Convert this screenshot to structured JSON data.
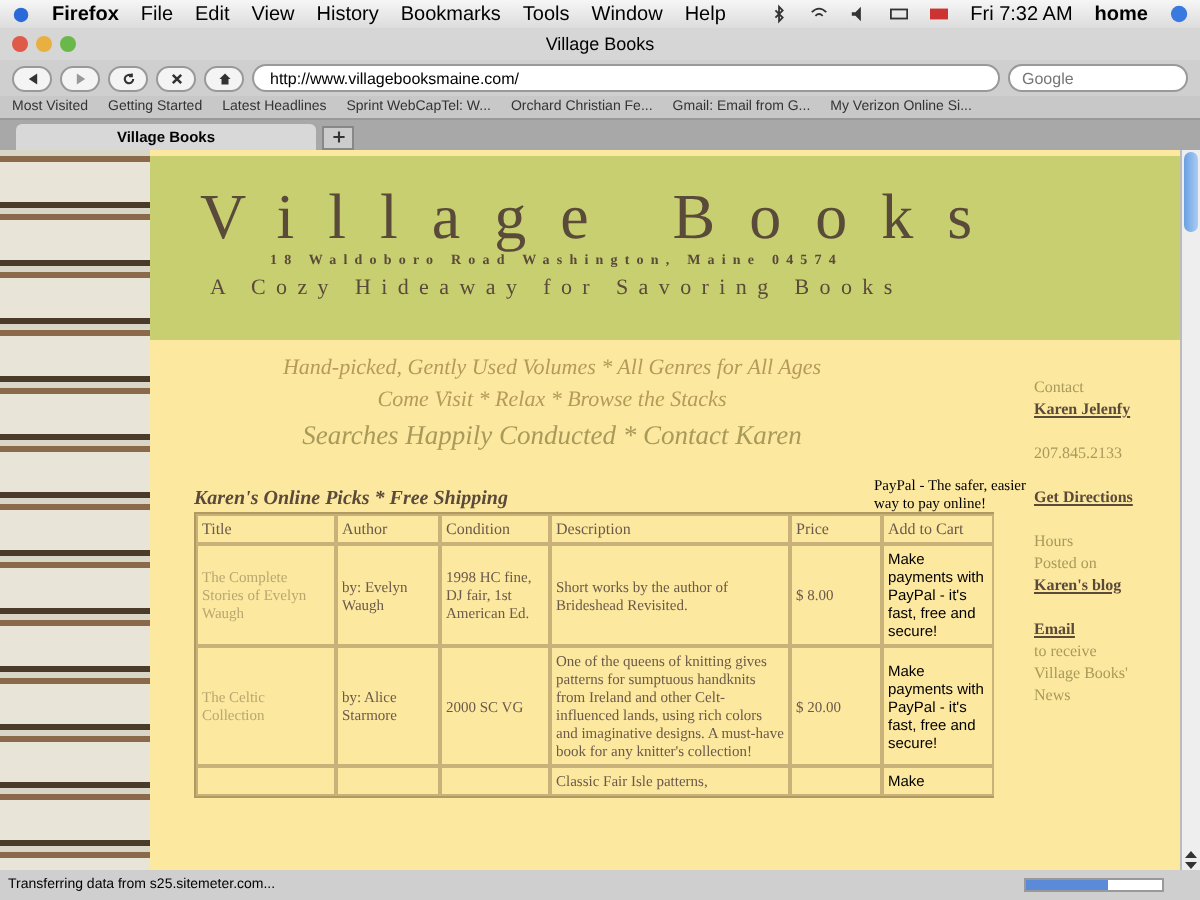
{
  "menu_bar": {
    "app": "Firefox",
    "items": [
      "File",
      "Edit",
      "View",
      "History",
      "Bookmarks",
      "Tools",
      "Window",
      "Help"
    ],
    "clock": "Fri 7:32 AM",
    "user": "home"
  },
  "window": {
    "title": "Village Books"
  },
  "toolbar": {
    "url": "http://www.villagebooksmaine.com/",
    "search_placeholder": "Google"
  },
  "bookmarks": [
    "Most Visited",
    "Getting Started",
    "Latest Headlines",
    "Sprint WebCapTel: W...",
    "Orchard Christian Fe...",
    "Gmail: Email from G...",
    "My Verizon Online Si..."
  ],
  "tabs": [
    {
      "label": "Village Books",
      "selected": true
    }
  ],
  "header": {
    "title": "Village Books",
    "address": "18 Waldoboro Road Washington, Maine 04574",
    "tagline": "A Cozy Hideaway for Savoring Books"
  },
  "slogans": [
    "Hand-picked, Gently Used Volumes * All Genres for All Ages",
    "Come Visit * Relax * Browse the Stacks"
  ],
  "slogan_links": "Searches Happily Conducted * Contact Karen",
  "sidebar": [
    {
      "kind": "text",
      "text": "Contact"
    },
    {
      "kind": "link",
      "text": "Karen Jelenfy"
    },
    {
      "kind": "gap"
    },
    {
      "kind": "text",
      "text": "207.845.2133"
    },
    {
      "kind": "gap"
    },
    {
      "kind": "link",
      "text": "Get Directions"
    },
    {
      "kind": "gap"
    },
    {
      "kind": "text",
      "text": "Hours"
    },
    {
      "kind": "text",
      "text": "Posted on"
    },
    {
      "kind": "link",
      "text": "Karen's blog"
    },
    {
      "kind": "gap"
    },
    {
      "kind": "link",
      "text": "Email"
    },
    {
      "kind": "text",
      "text": "to receive"
    },
    {
      "kind": "text",
      "text": "Village Books'"
    },
    {
      "kind": "text",
      "text": "News"
    }
  ],
  "picks_heading": "Karen's Online Picks * Free Shipping",
  "paypal_note": "PayPal - The safer, easier way to pay online!",
  "table": {
    "columns": [
      "Title",
      "Author",
      "Condition",
      "Description",
      "Price",
      "Add to Cart"
    ],
    "rows": [
      {
        "title": "The Complete Stories of Evelyn Waugh",
        "author": "by: Evelyn Waugh",
        "condition": "1998 HC fine, DJ fair, 1st American Ed.",
        "description": "Short works by the author of Brideshead Revisited.",
        "price": "$ 8.00",
        "cart": "Make payments with PayPal - it's fast, free and secure!"
      },
      {
        "title": "The Celtic Collection",
        "author": "by: Alice Starmore",
        "condition": "2000 SC VG",
        "description": "One of the queens of knitting gives patterns for sumptuous handknits from Ireland and other Celt-influenced lands, using rich colors and imaginative designs. A must-have book for any knitter's collection!",
        "price": "$ 20.00",
        "cart": "Make payments with PayPal - it's fast, free and secure!"
      },
      {
        "title": "",
        "author": "",
        "condition": "",
        "description": "Classic Fair Isle patterns,",
        "price": "",
        "cart": "Make"
      }
    ]
  },
  "status": {
    "text": "Transferring data from s25.sitemeter.com...",
    "level": 0.6
  }
}
